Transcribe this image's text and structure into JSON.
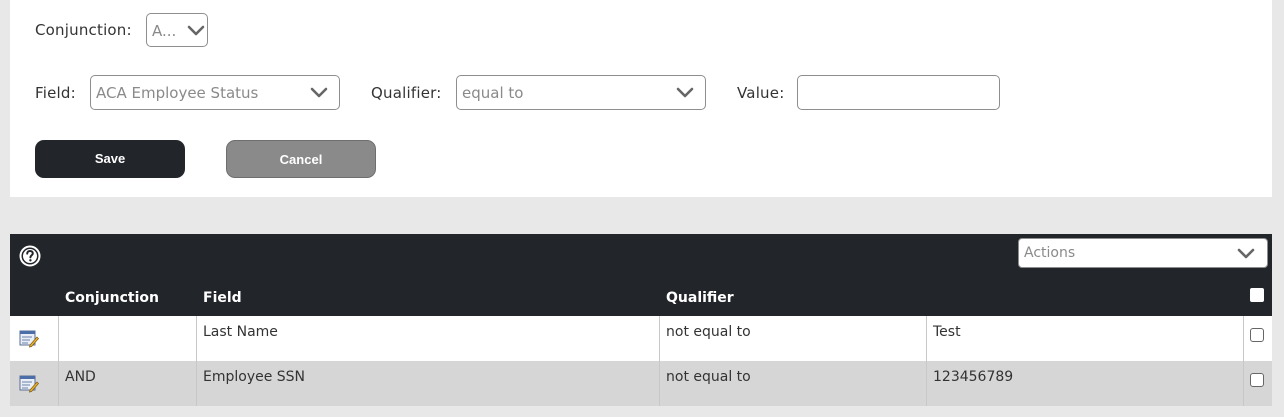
{
  "form": {
    "conjunction_label": "Conjunction:",
    "conjunction_value": "A...",
    "field_label": "Field:",
    "field_value": "ACA Employee Status",
    "qualifier_label": "Qualifier:",
    "qualifier_value": "equal to",
    "value_label": "Value:",
    "value_input": "",
    "save_label": "Save",
    "cancel_label": "Cancel"
  },
  "grid": {
    "actions_placeholder": "Actions",
    "columns": [
      "Conjunction",
      "Field",
      "Qualifier"
    ],
    "rows": [
      {
        "conjunction": "",
        "field": "Last Name",
        "qualifier": "not equal to",
        "value": "Test"
      },
      {
        "conjunction": "AND",
        "field": "Employee SSN",
        "qualifier": "not equal to",
        "value": "123456789"
      }
    ]
  },
  "icons": {
    "help": "help-circle-icon",
    "edit": "edit-record-icon",
    "dropdown": "chevron-down-icon"
  },
  "colors": {
    "header_bg": "#22262b",
    "save_button": "#22262b",
    "cancel_button": "#8a8a8a",
    "alt_row": "#d6d6d6"
  }
}
